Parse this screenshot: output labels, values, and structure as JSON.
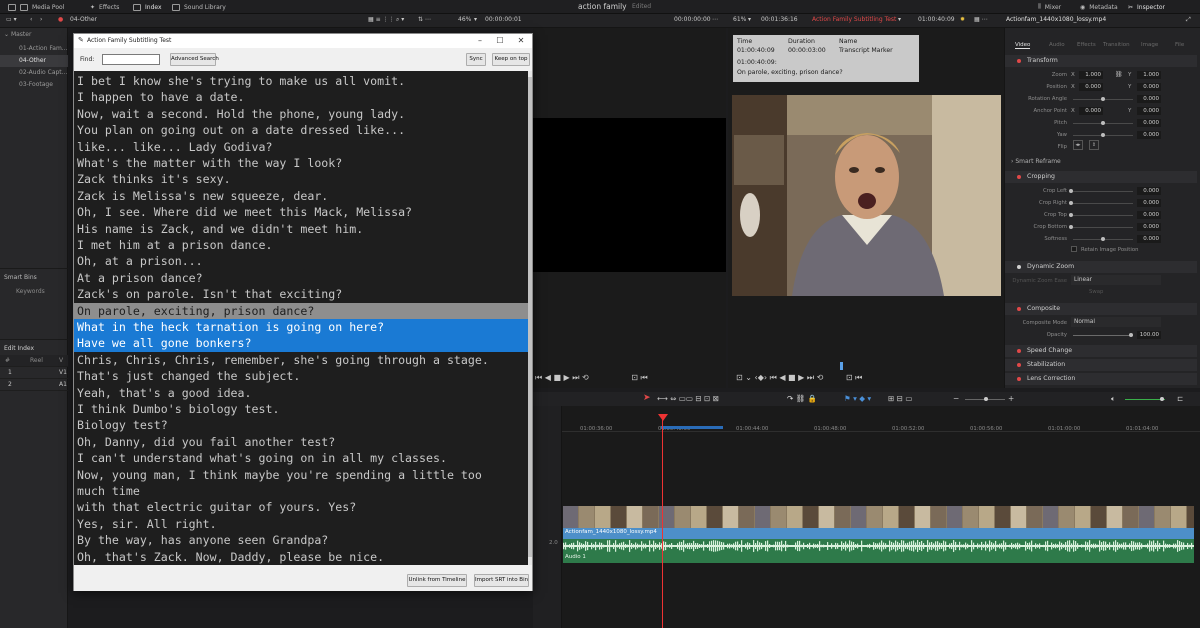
{
  "topbar": {
    "media_pool": "Media Pool",
    "effects": "Effects",
    "index": "Index",
    "sound_library": "Sound Library",
    "project_title": "action family",
    "project_status": "Edited",
    "mixer": "Mixer",
    "metadata": "Metadata",
    "inspector": "Inspector"
  },
  "bar2": {
    "bin_name": "04-Other",
    "src_zoom": "46%",
    "src_tc": "00:00:00:01",
    "src_tc2": "00:00:00:00",
    "rec_zoom": "61%",
    "rec_duration": "00:01:36:16",
    "timeline_name": "Action Family Subtitling Test",
    "rec_tc": "01:00:40:09",
    "clip_name": "Actionfam_1440x1080_lossy.mp4"
  },
  "bins": {
    "master": "Master",
    "items": [
      "01-Action Fam...",
      "04-Other",
      "02-Audio Capt...",
      "03-Footage"
    ],
    "selected_index": 1,
    "smart_bins": "Smart Bins",
    "keywords": "Keywords"
  },
  "edit_index": {
    "title": "Edit Index",
    "headers": [
      "#",
      "Reel",
      "V"
    ],
    "rows": [
      [
        "1",
        "",
        "V1"
      ],
      [
        "2",
        "",
        "A1"
      ]
    ]
  },
  "subtitle_window": {
    "title": "Action Family Subtitling Test",
    "find_label": "Find:",
    "find_value": "",
    "advanced_search": "Advanced Search",
    "sync": "Sync",
    "keep_on_top": "Keep on top",
    "unlink": "Unlink from Timeline",
    "import_srt": "Import SRT into Bin",
    "lines": [
      "I bet I know she's trying to make us all vomit.",
      "I happen to have a date.",
      "Now, wait a second. Hold the phone, young lady.",
      "You plan on going out on a date dressed like...",
      "like... like... Lady Godiva?",
      "What's the matter with the way I look?",
      "Zack thinks it's sexy.",
      "Zack is Melissa's new squeeze, dear.",
      "Oh, I see. Where did we meet this Mack, Melissa?",
      "His name is Zack, and we didn't meet him.",
      "I met him at a prison dance.",
      "Oh, at a prison...",
      "At a prison dance?",
      "Zack's on parole. Isn't that exciting?",
      "On parole, exciting, prison dance?",
      "What in the heck tarnation is going on here?",
      "Have we all gone bonkers?",
      "Chris, Chris, Chris, remember, she's going through a stage.",
      "That's just changed the subject.",
      "Yeah, that's a good idea.",
      "I think Dumbo's biology test.",
      "Biology test?",
      "Oh, Danny, did you fail another test?",
      "I can't understand what's going on in all my classes.",
      "Now, young man, I think maybe you're spending a little too",
      "much time",
      "with that electric guitar of yours. Yes?",
      "Yes, sir. All right.",
      "By the way, has anyone seen Grandpa?",
      "Oh, that's Zack. Now, Daddy, please be nice."
    ],
    "current_line_index": 14,
    "selected_line_indices": [
      15,
      16
    ]
  },
  "marker": {
    "time_label": "Time",
    "duration_label": "Duration",
    "name_label": "Name",
    "time": "01:00:40:09",
    "duration": "00:00:03:00",
    "name": "Transcript Marker",
    "note_tc": "01:00:40:09:",
    "note_text": "On parole, exciting, prison dance?"
  },
  "inspector": {
    "tabs": [
      "Video",
      "Audio",
      "Effects",
      "Transition",
      "Image",
      "File"
    ],
    "active_tab": "Video",
    "transform": {
      "title": "Transform",
      "zoom_label": "Zoom",
      "zoom_x": "1.000",
      "zoom_y": "1.000",
      "position_label": "Position",
      "pos_x": "0.000",
      "pos_y": "0.000",
      "rotation_label": "Rotation Angle",
      "rotation": "0.000",
      "anchor_label": "Anchor Point",
      "anchor_x": "0.000",
      "anchor_y": "0.000",
      "pitch_label": "Pitch",
      "pitch": "0.000",
      "yaw_label": "Yaw",
      "yaw": "0.000",
      "flip_label": "Flip",
      "x_label": "X",
      "y_label": "Y"
    },
    "smart_reframe": "Smart Reframe",
    "cropping": {
      "title": "Cropping",
      "crop_left_label": "Crop Left",
      "crop_left": "0.000",
      "crop_right_label": "Crop Right",
      "crop_right": "0.000",
      "crop_top_label": "Crop Top",
      "crop_top": "0.000",
      "crop_bottom_label": "Crop Bottom",
      "crop_bottom": "0.000",
      "softness_label": "Softness",
      "softness": "0.000",
      "retain_label": "Retain Image Position"
    },
    "dynamic_zoom": {
      "title": "Dynamic Zoom",
      "ease_label": "Dynamic Zoom Ease",
      "ease_value": "Linear",
      "swap": "Swap"
    },
    "composite": {
      "title": "Composite",
      "mode_label": "Composite Mode",
      "mode": "Normal",
      "opacity_label": "Opacity",
      "opacity": "100.00"
    },
    "speed_change": "Speed Change",
    "stabilization": "Stabilization",
    "lens_correction": "Lens Correction"
  },
  "timeline": {
    "ruler": [
      "01:00:36:00",
      "01:00:40:00",
      "01:00:44:00",
      "01:00:48:00",
      "01:00:52:00",
      "01:00:56:00",
      "01:01:00:00",
      "01:01:04:00"
    ],
    "video_clip": "Actionfam_1440x1080_lossy.mp4",
    "audio_clip": "Audio 1",
    "audio_level": "2.0"
  },
  "colors": {
    "highlight_gray": "#8e8e8e",
    "highlight_blue": "#1a7ad4",
    "marker_red": "#e04848",
    "clip_blue": "#4d8fc9",
    "audio_green": "#2e7a4a"
  }
}
